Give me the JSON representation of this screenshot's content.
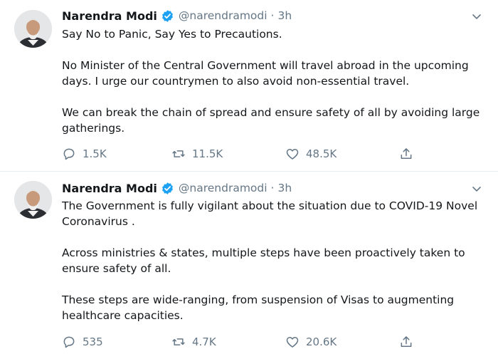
{
  "tweets": [
    {
      "author": {
        "name": "Narendra Modi",
        "handle": "@narendramodi",
        "verified": true
      },
      "separator": "·",
      "time": "3h",
      "paragraphs": [
        "Say No to Panic, Say Yes to Precautions.",
        "No Minister of the Central Government will travel abroad in the upcoming days. I urge our countrymen to also avoid non-essential travel.",
        "We can break the chain of spread and ensure safety of all by avoiding large gatherings."
      ],
      "stats": {
        "replies": "1.5K",
        "retweets": "11.5K",
        "likes": "48.5K"
      }
    },
    {
      "author": {
        "name": "Narendra Modi",
        "handle": "@narendramodi",
        "verified": true
      },
      "separator": "·",
      "time": "3h",
      "paragraphs": [
        "The Government is fully vigilant about the situation due to COVID-19 Novel Coronavirus .",
        "Across ministries & states, multiple steps have been proactively taken to ensure safety of all.",
        "These steps are wide-ranging, from suspension of Visas to augmenting healthcare capacities."
      ],
      "stats": {
        "replies": "535",
        "retweets": "4.7K",
        "likes": "20.6K"
      }
    }
  ],
  "colors": {
    "text": "#14171a",
    "secondary": "#657786",
    "verified": "#1da1f2",
    "divider": "#e6ecf0"
  },
  "icons": {
    "reply": "reply-icon",
    "retweet": "retweet-icon",
    "like": "heart-icon",
    "share": "share-icon",
    "more": "chevron-down-icon",
    "verified": "verified-badge-icon"
  }
}
